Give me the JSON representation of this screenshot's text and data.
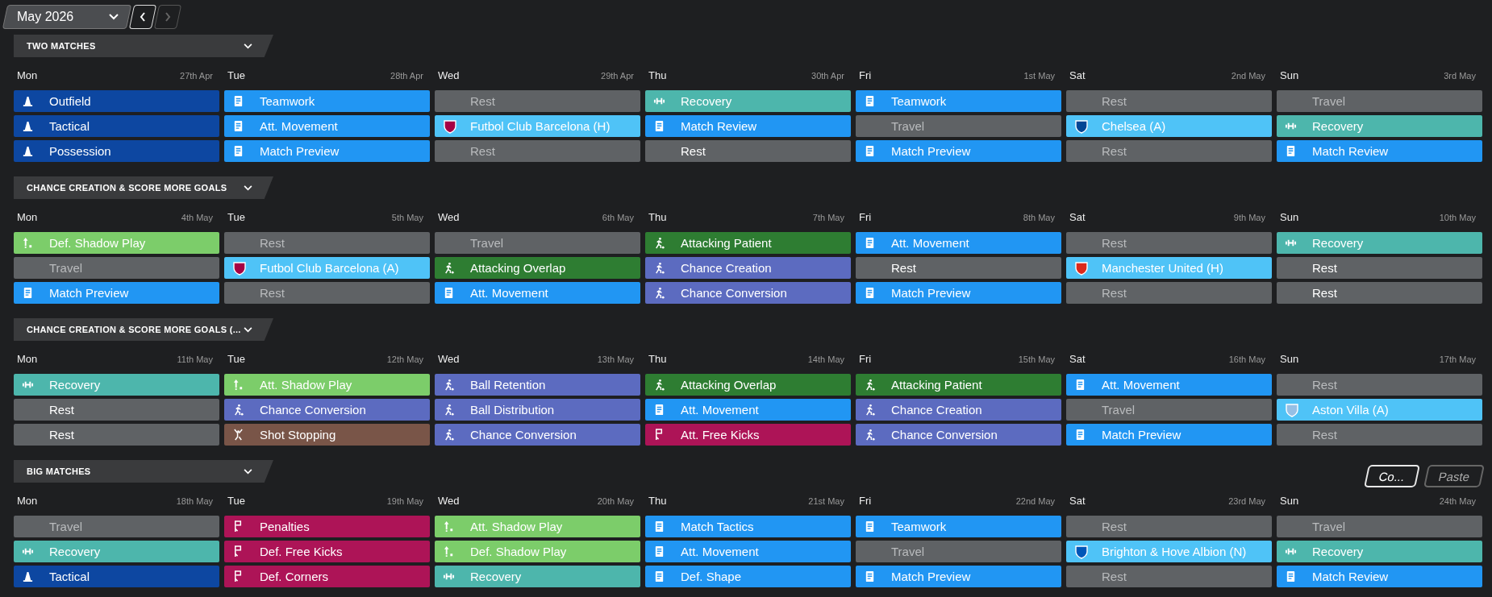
{
  "month": {
    "label": "May 2026"
  },
  "nav": [
    {
      "kind": "prev",
      "disabled": false
    },
    {
      "kind": "next",
      "disabled": true
    }
  ],
  "weeks": [
    {
      "title": "TWO MATCHES",
      "days": [
        {
          "day": "Mon",
          "date": "27th Apr",
          "sessions": [
            {
              "label": "Outfield",
              "kind": "general",
              "dimmed": false
            },
            {
              "label": "Tactical",
              "kind": "general",
              "dimmed": false
            },
            {
              "label": "Possession",
              "kind": "general",
              "dimmed": false
            }
          ]
        },
        {
          "day": "Tue",
          "date": "28th Apr",
          "sessions": [
            {
              "label": "Teamwork",
              "kind": "tactical",
              "dimmed": false
            },
            {
              "label": "Att. Movement",
              "kind": "tactical",
              "dimmed": false
            },
            {
              "label": "Match Preview",
              "kind": "tactical",
              "dimmed": false
            }
          ]
        },
        {
          "day": "Wed",
          "date": "29th Apr",
          "sessions": [
            {
              "label": "Rest",
              "kind": "rest",
              "dimmed": true
            },
            {
              "label": "Futbol Club Barcelona (H)",
              "kind": "match",
              "color": "#a50044",
              "dimmed": false
            },
            {
              "label": "Rest",
              "kind": "rest",
              "dimmed": true
            }
          ]
        },
        {
          "day": "Thu",
          "date": "30th Apr",
          "sessions": [
            {
              "label": "Recovery",
              "kind": "recovery",
              "dimmed": false
            },
            {
              "label": "Match Review",
              "kind": "tactical",
              "dimmed": false
            },
            {
              "label": "Rest",
              "kind": "rest",
              "dimmed": false
            }
          ]
        },
        {
          "day": "Fri",
          "date": "1st May",
          "sessions": [
            {
              "label": "Teamwork",
              "kind": "tactical",
              "dimmed": false
            },
            {
              "label": "Travel",
              "kind": "rest",
              "dimmed": true
            },
            {
              "label": "Match Preview",
              "kind": "tactical",
              "dimmed": false
            }
          ]
        },
        {
          "day": "Sat",
          "date": "2nd May",
          "sessions": [
            {
              "label": "Rest",
              "kind": "rest",
              "dimmed": true
            },
            {
              "label": "Chelsea (A)",
              "kind": "match",
              "color": "#034694",
              "dimmed": false
            },
            {
              "label": "Rest",
              "kind": "rest",
              "dimmed": true
            }
          ]
        },
        {
          "day": "Sun",
          "date": "3rd May",
          "sessions": [
            {
              "label": "Travel",
              "kind": "rest",
              "dimmed": true
            },
            {
              "label": "Recovery",
              "kind": "recovery",
              "dimmed": false
            },
            {
              "label": "Match Review",
              "kind": "tactical",
              "dimmed": false
            }
          ]
        }
      ]
    },
    {
      "title": "CHANCE CREATION & SCORE MORE GOALS",
      "days": [
        {
          "day": "Mon",
          "date": "4th May",
          "sessions": [
            {
              "label": "Def. Shadow Play",
              "kind": "shadow",
              "dimmed": false
            },
            {
              "label": "Travel",
              "kind": "rest",
              "dimmed": true
            },
            {
              "label": "Match Preview",
              "kind": "tactical",
              "dimmed": false
            }
          ]
        },
        {
          "day": "Tue",
          "date": "5th May",
          "sessions": [
            {
              "label": "Rest",
              "kind": "rest",
              "dimmed": true
            },
            {
              "label": "Futbol Club Barcelona (A)",
              "kind": "match",
              "color": "#a50044",
              "dimmed": false
            },
            {
              "label": "Rest",
              "kind": "rest",
              "dimmed": true
            }
          ]
        },
        {
          "day": "Wed",
          "date": "6th May",
          "sessions": [
            {
              "label": "Travel",
              "kind": "rest",
              "dimmed": true
            },
            {
              "label": "Attacking Overlap",
              "kind": "attacking",
              "dimmed": false
            },
            {
              "label": "Att. Movement",
              "kind": "tactical",
              "dimmed": false
            }
          ]
        },
        {
          "day": "Thu",
          "date": "7th May",
          "sessions": [
            {
              "label": "Attacking Patient",
              "kind": "attacking",
              "dimmed": false
            },
            {
              "label": "Chance Creation",
              "kind": "unit",
              "dimmed": false
            },
            {
              "label": "Chance Conversion",
              "kind": "unit",
              "dimmed": false
            }
          ]
        },
        {
          "day": "Fri",
          "date": "8th May",
          "sessions": [
            {
              "label": "Att. Movement",
              "kind": "tactical",
              "dimmed": false
            },
            {
              "label": "Rest",
              "kind": "rest",
              "dimmed": false
            },
            {
              "label": "Match Preview",
              "kind": "tactical",
              "dimmed": false
            }
          ]
        },
        {
          "day": "Sat",
          "date": "9th May",
          "sessions": [
            {
              "label": "Rest",
              "kind": "rest",
              "dimmed": true
            },
            {
              "label": "Manchester United (H)",
              "kind": "match",
              "color": "#da291c",
              "dimmed": false
            },
            {
              "label": "Rest",
              "kind": "rest",
              "dimmed": true
            }
          ]
        },
        {
          "day": "Sun",
          "date": "10th May",
          "sessions": [
            {
              "label": "Recovery",
              "kind": "recovery",
              "dimmed": false
            },
            {
              "label": "Rest",
              "kind": "rest",
              "dimmed": false
            },
            {
              "label": "Rest",
              "kind": "rest",
              "dimmed": false
            }
          ]
        }
      ]
    },
    {
      "title": "CHANCE CREATION & SCORE MORE GOALS (...",
      "days": [
        {
          "day": "Mon",
          "date": "11th May",
          "sessions": [
            {
              "label": "Recovery",
              "kind": "recovery",
              "dimmed": false
            },
            {
              "label": "Rest",
              "kind": "rest",
              "dimmed": false
            },
            {
              "label": "Rest",
              "kind": "rest",
              "dimmed": false
            }
          ]
        },
        {
          "day": "Tue",
          "date": "12th May",
          "sessions": [
            {
              "label": "Att. Shadow Play",
              "kind": "shadow",
              "dimmed": false
            },
            {
              "label": "Chance Conversion",
              "kind": "unit",
              "dimmed": false
            },
            {
              "label": "Shot Stopping",
              "kind": "goalkeeping",
              "dimmed": false
            }
          ]
        },
        {
          "day": "Wed",
          "date": "13th May",
          "sessions": [
            {
              "label": "Ball Retention",
              "kind": "unit",
              "dimmed": false
            },
            {
              "label": "Ball Distribution",
              "kind": "unit",
              "dimmed": false
            },
            {
              "label": "Chance Conversion",
              "kind": "unit",
              "dimmed": false
            }
          ]
        },
        {
          "day": "Thu",
          "date": "14th May",
          "sessions": [
            {
              "label": "Attacking Overlap",
              "kind": "attacking",
              "dimmed": false
            },
            {
              "label": "Att. Movement",
              "kind": "tactical",
              "dimmed": false
            },
            {
              "label": "Att. Free Kicks",
              "kind": "setpiece",
              "dimmed": false
            }
          ]
        },
        {
          "day": "Fri",
          "date": "15th May",
          "sessions": [
            {
              "label": "Attacking Patient",
              "kind": "attacking",
              "dimmed": false
            },
            {
              "label": "Chance Creation",
              "kind": "unit",
              "dimmed": false
            },
            {
              "label": "Chance Conversion",
              "kind": "unit",
              "dimmed": false
            }
          ]
        },
        {
          "day": "Sat",
          "date": "16th May",
          "sessions": [
            {
              "label": "Att. Movement",
              "kind": "tactical",
              "dimmed": false
            },
            {
              "label": "Travel",
              "kind": "rest",
              "dimmed": true
            },
            {
              "label": "Match Preview",
              "kind": "tactical",
              "dimmed": false
            }
          ]
        },
        {
          "day": "Sun",
          "date": "17th May",
          "sessions": [
            {
              "label": "Rest",
              "kind": "rest",
              "dimmed": true
            },
            {
              "label": "Aston Villa (A)",
              "kind": "match",
              "color": "#95bfe5",
              "dimmed": false
            },
            {
              "label": "Rest",
              "kind": "rest",
              "dimmed": true
            }
          ]
        }
      ]
    },
    {
      "title": "BIG MATCHES",
      "buttons": [
        {
          "label": "Co...",
          "disabled": false
        },
        {
          "label": "Paste",
          "disabled": true
        }
      ],
      "days": [
        {
          "day": "Mon",
          "date": "18th May",
          "sessions": [
            {
              "label": "Travel",
              "kind": "rest",
              "dimmed": true
            },
            {
              "label": "Recovery",
              "kind": "recovery",
              "dimmed": false
            },
            {
              "label": "Tactical",
              "kind": "general",
              "dimmed": false
            }
          ]
        },
        {
          "day": "Tue",
          "date": "19th May",
          "sessions": [
            {
              "label": "Penalties",
              "kind": "setpiece",
              "dimmed": false
            },
            {
              "label": "Def. Free Kicks",
              "kind": "setpiece",
              "dimmed": false
            },
            {
              "label": "Def. Corners",
              "kind": "setpiece",
              "dimmed": false
            }
          ]
        },
        {
          "day": "Wed",
          "date": "20th May",
          "sessions": [
            {
              "label": "Att. Shadow Play",
              "kind": "shadow",
              "dimmed": false
            },
            {
              "label": "Def. Shadow Play",
              "kind": "shadow",
              "dimmed": false
            },
            {
              "label": "Recovery",
              "kind": "recovery",
              "dimmed": false
            }
          ]
        },
        {
          "day": "Thu",
          "date": "21st May",
          "sessions": [
            {
              "label": "Match Tactics",
              "kind": "tactical",
              "dimmed": false
            },
            {
              "label": "Att. Movement",
              "kind": "tactical",
              "dimmed": false
            },
            {
              "label": "Def. Shape",
              "kind": "tactical",
              "dimmed": false
            }
          ]
        },
        {
          "day": "Fri",
          "date": "22nd May",
          "sessions": [
            {
              "label": "Teamwork",
              "kind": "tactical",
              "dimmed": false
            },
            {
              "label": "Travel",
              "kind": "rest",
              "dimmed": true
            },
            {
              "label": "Match Preview",
              "kind": "tactical",
              "dimmed": false
            }
          ]
        },
        {
          "day": "Sat",
          "date": "23rd May",
          "sessions": [
            {
              "label": "Rest",
              "kind": "rest",
              "dimmed": true
            },
            {
              "label": "Brighton & Hove Albion (N)",
              "kind": "match",
              "color": "#0057b8",
              "dimmed": false
            },
            {
              "label": "Rest",
              "kind": "rest",
              "dimmed": true
            }
          ]
        },
        {
          "day": "Sun",
          "date": "24th May",
          "sessions": [
            {
              "label": "Travel",
              "kind": "rest",
              "dimmed": true
            },
            {
              "label": "Recovery",
              "kind": "recovery",
              "dimmed": false
            },
            {
              "label": "Match Review",
              "kind": "tactical",
              "dimmed": false
            }
          ]
        }
      ]
    }
  ]
}
